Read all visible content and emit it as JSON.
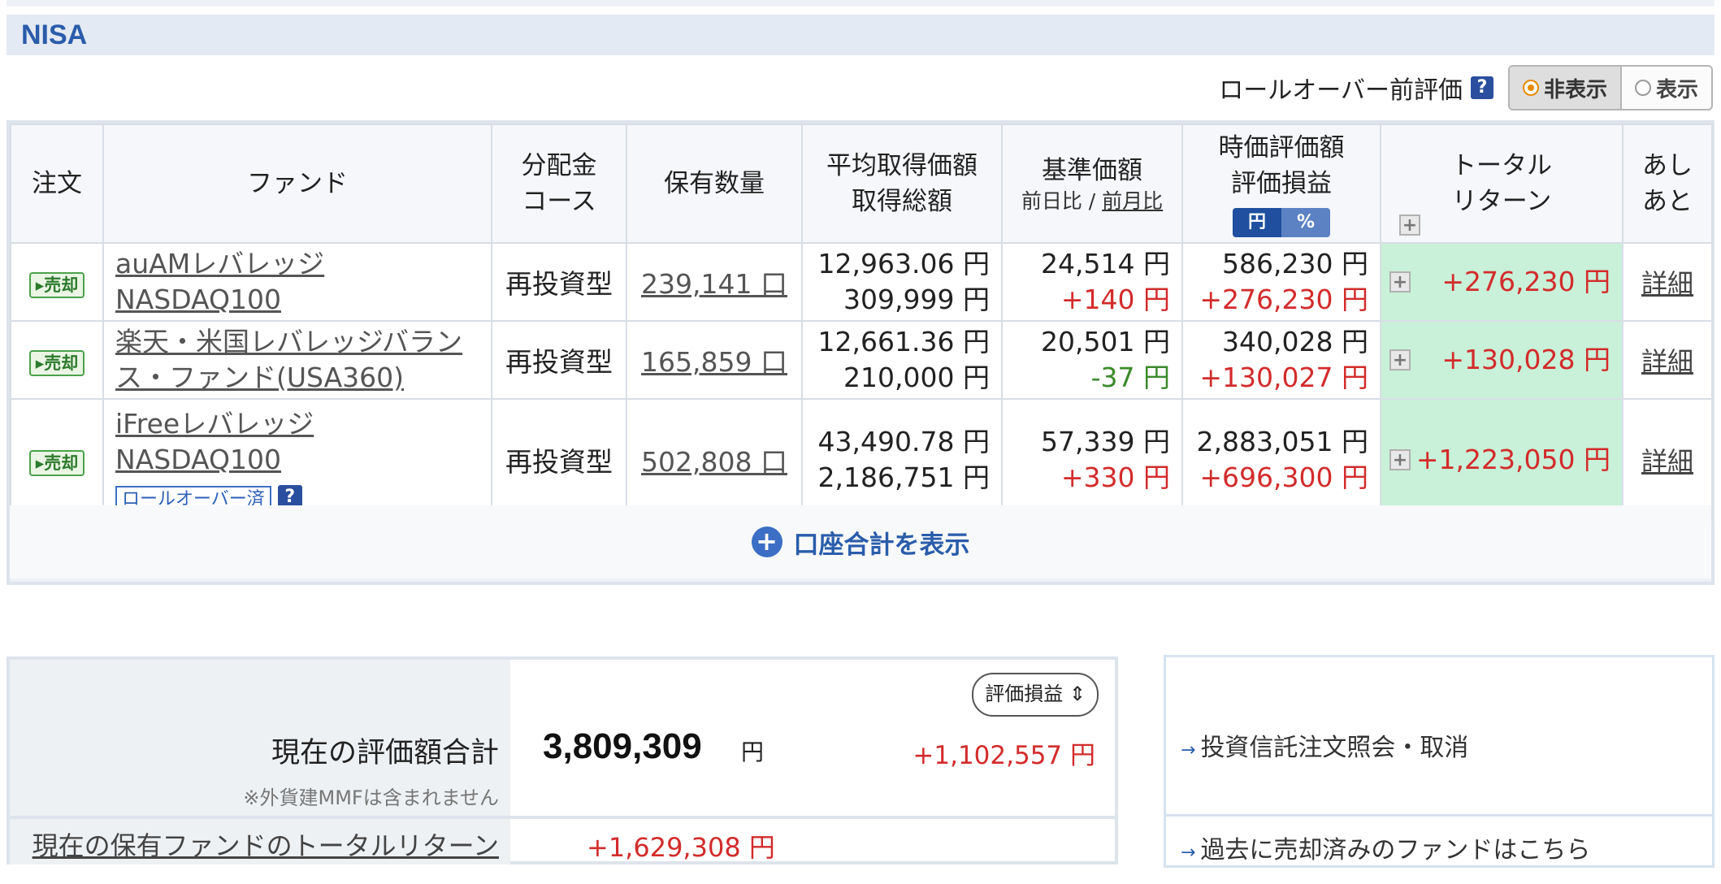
{
  "section": {
    "title": "NISA"
  },
  "rollover": {
    "label": "ロールオーバー前評価",
    "help": "?",
    "options": [
      "非表示",
      "表示"
    ],
    "selected": "非表示"
  },
  "table": {
    "headers": {
      "order": "注文",
      "fund": "ファンド",
      "dist1": "分配金",
      "dist2": "コース",
      "qty": "保有数量",
      "avg1": "平均取得価額",
      "avg2": "取得総額",
      "base1": "基準価額",
      "base_sub_day": "前日比",
      "base_sub_sep": "/",
      "base_sub_month": "前月比",
      "mkt1": "時価評価額",
      "mkt2": "評価損益",
      "unit_yen": "円",
      "unit_pct": "%",
      "tr1": "トータル",
      "tr2": "リターン",
      "ashi1": "あし",
      "ashi2": "あと"
    },
    "rows": [
      {
        "badge": "売却",
        "fund_l1": "auAMレバレッジ",
        "fund_l2": "NASDAQ100",
        "course": "再投資型",
        "qty": "239,141 口",
        "avg_price": "12,963.06 円",
        "total_cost": "309,999 円",
        "base_price": "24,514 円",
        "base_change": "+140 円",
        "market_value": "586,230 円",
        "unrealized": "+276,230 円",
        "total_return": "+276,230 円",
        "detail": "詳細"
      },
      {
        "badge": "売却",
        "fund_l1": "楽天・米国レバレッジバラン",
        "fund_l2": "ス・ファンド(USA360)",
        "course": "再投資型",
        "qty": "165,859 口",
        "avg_price": "12,661.36 円",
        "total_cost": "210,000 円",
        "base_price": "20,501 円",
        "base_change": "-37 円",
        "market_value": "340,028 円",
        "unrealized": "+130,027 円",
        "total_return": "+130,028 円",
        "detail": "詳細"
      },
      {
        "badge": "売却",
        "fund_l1": "iFreeレバレッジ",
        "fund_l2": "NASDAQ100",
        "rollover_tag": "ロールオーバー済",
        "help": "?",
        "course": "再投資型",
        "qty": "502,808 口",
        "avg_price": "43,490.78 円",
        "total_cost": "2,186,751 円",
        "base_price": "57,339 円",
        "base_change": "+330 円",
        "market_value": "2,883,051 円",
        "unrealized": "+696,300 円",
        "total_return": "+1,223,050 円",
        "detail": "詳細"
      }
    ],
    "show_total": "口座合計を表示"
  },
  "summary": {
    "label": "現在の評価額合計",
    "note": "※外貨建MMFは含まれません",
    "value": "3,809,309",
    "unit": "円",
    "select": "評価損益",
    "gain": "+1,102,557 円",
    "tr_label": "現在の保有ファンドのトータルリターン",
    "tr_value": "+1,629,308 円"
  },
  "links": {
    "order_inquiry": "投資信託注文照会・取消",
    "sold_funds": "過去に売却済みのファンドはこちら"
  },
  "colors": {
    "accent": "#2a5caa",
    "gain": "#d32b2b",
    "loss": "#3b8a2a",
    "return_bg": "#c9f0d8"
  }
}
